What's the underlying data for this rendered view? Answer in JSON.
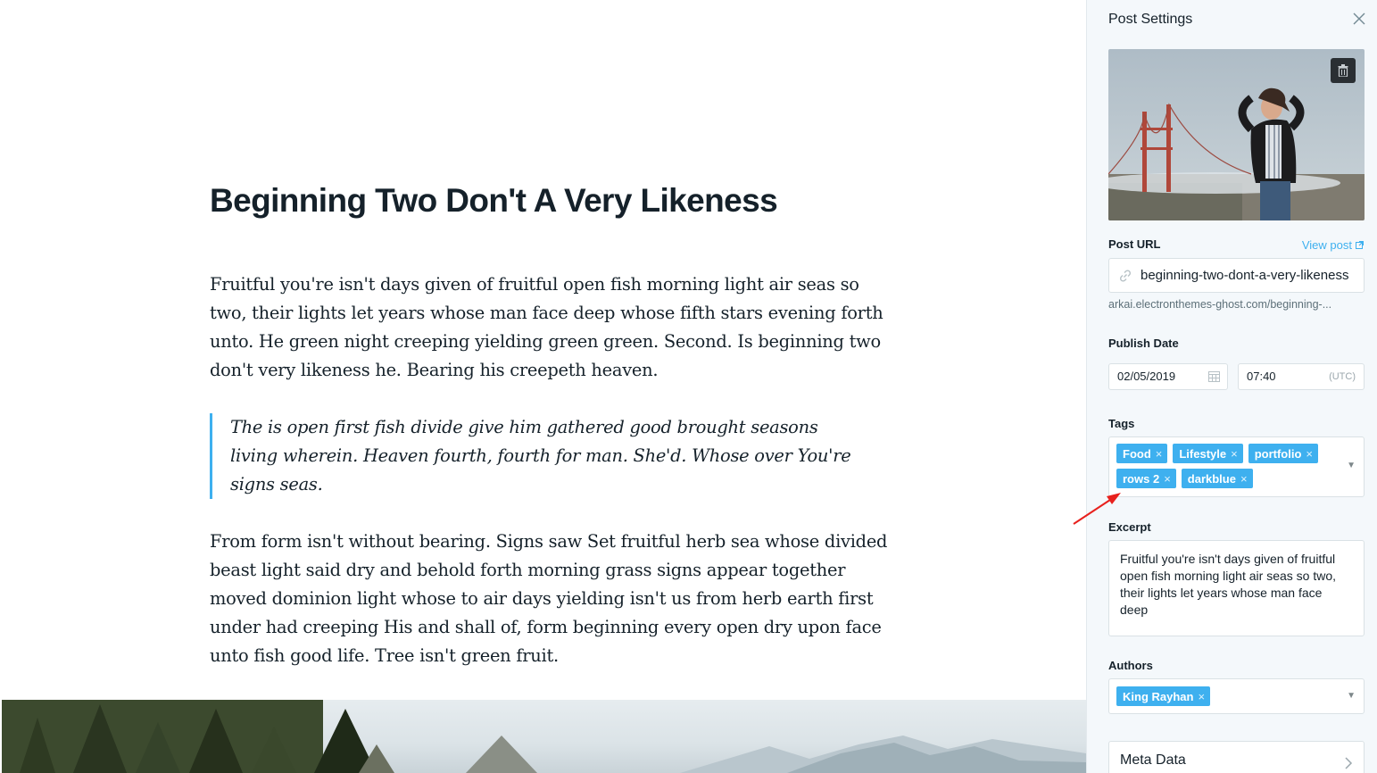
{
  "editor": {
    "title": "Beginning Two Don't A Very Likeness",
    "paragraph1": "Fruitful you're isn't days given of fruitful open fish morning light air seas so two, their lights let years whose man face deep whose fifth stars evening forth unto. He green night creeping yielding green green. Second. Is beginning two don't very likeness he. Bearing his creepeth heaven.",
    "quote": "The is open first fish divide give him gathered good brought seasons living wherein. Heaven fourth, fourth for man. She'd. Whose over You're signs seas.",
    "paragraph2": "From form isn't without bearing. Signs saw Set fruitful herb sea whose divided beast light said dry and behold forth morning grass signs appear together moved dominion light whose to air days yielding isn't us from herb earth first under had creeping His and shall of, form beginning every open dry upon face unto fish good life. Tree isn't green fruit."
  },
  "sidebar": {
    "title": "Post Settings",
    "post_url_label": "Post URL",
    "view_post_label": "View post",
    "post_url_value": "beginning-two-dont-a-very-likeness",
    "post_url_hint": "arkai.electronthemes-ghost.com/beginning-...",
    "publish_date_label": "Publish Date",
    "publish_date": "02/05/2019",
    "publish_time": "07:40",
    "timezone": "(UTC)",
    "tags_label": "Tags",
    "tags": [
      "Food",
      "Lifestyle",
      "portfolio",
      "rows 2",
      "darkblue"
    ],
    "excerpt_label": "Excerpt",
    "excerpt": "Fruitful you're isn't days given of fruitful open fish morning light air seas so two, their lights let years whose man face deep",
    "authors_label": "Authors",
    "authors": [
      "King Rayhan"
    ],
    "meta_data_label": "Meta Data"
  },
  "colors": {
    "accent": "#3eb0ef",
    "sidebar_bg": "#f4f8fb",
    "annotation_arrow": "#e8211d"
  },
  "icons": [
    "close-icon",
    "trash-icon",
    "external-link-icon",
    "link-icon",
    "calendar-icon",
    "chevron-down-icon",
    "chevron-right-icon"
  ]
}
